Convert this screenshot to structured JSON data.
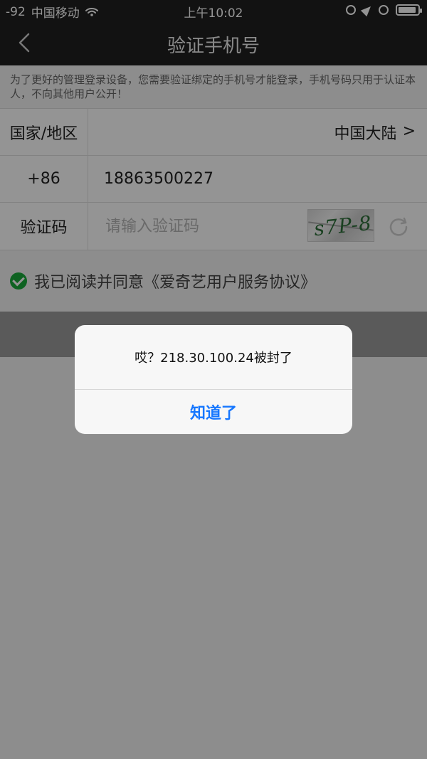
{
  "status_bar": {
    "signal": "-92",
    "carrier": "中国移动",
    "time": "上午10:02",
    "battery_level": 0.85
  },
  "navbar": {
    "title": "验证手机号"
  },
  "notice": {
    "text": "为了更好的管理登录设备，您需要验证绑定的手机号才能登录，手机号码只用于认证本人，不向其他用户公开！"
  },
  "form": {
    "country_label": "国家/地区",
    "country_value": "中国大陆",
    "country_chevron": ">",
    "phone_prefix": "+86",
    "phone_number": "18863500227",
    "verification_label": "验证码",
    "verification_placeholder": "请输入验证码",
    "captcha_text": "s7P-8"
  },
  "agreement": {
    "text": "我已阅读并同意《爱奇艺用户服务协议》"
  },
  "alert": {
    "message": "哎？218.30.100.24被封了",
    "button": "知道了"
  },
  "colors": {
    "accent": "#1677ff",
    "success": "#19a93a",
    "nav_bg": "#1f1f1f"
  },
  "icons": {
    "back": "back-chevron-icon",
    "wifi": "wifi-icon",
    "location": "location-arrow-icon",
    "alarm": "alarm-icon",
    "battery": "battery-icon",
    "refresh": "refresh-icon",
    "check": "check-circle-icon"
  }
}
